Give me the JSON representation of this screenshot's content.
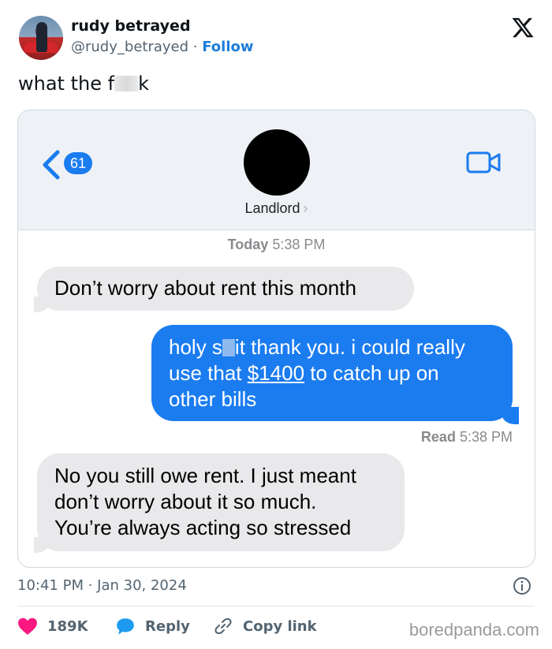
{
  "author": {
    "display_name": "rudy betrayed",
    "handle": "@rudy_betrayed",
    "separator": "·",
    "follow_label": "Follow"
  },
  "tweet": {
    "text_prefix": "what the f",
    "text_suffix": "k",
    "posted_time": "10:41 PM · Jan 30, 2024"
  },
  "chat": {
    "back_count": "61",
    "contact_name": "Landlord",
    "contact_chevron": "›",
    "day_label": "Today",
    "day_time": "5:38 PM",
    "messages": [
      {
        "direction": "incoming",
        "text": "Don’t worry about rent this month"
      },
      {
        "direction": "outgoing",
        "line1_a": "holy s",
        "line1_b": "it thank you. i could really",
        "line2_a": "use that ",
        "line2_link": "$1400",
        "line2_b": " to catch up on",
        "line3": "other bills"
      },
      {
        "direction": "incoming",
        "line1": "No you still owe rent. I just meant",
        "line2": "don’t worry about it so much.",
        "line3": "You’re always acting so stressed"
      }
    ],
    "read_label": "Read",
    "read_time": "5:38 PM",
    "colors": {
      "outgoing": "#1b7cf0",
      "incoming": "#e9e9eb"
    }
  },
  "actions": {
    "like_count": "189K",
    "reply_label": "Reply",
    "copy_label": "Copy link",
    "like_color": "#f91880",
    "reply_color": "#1d9bf0"
  },
  "watermark": "boredpanda.com"
}
